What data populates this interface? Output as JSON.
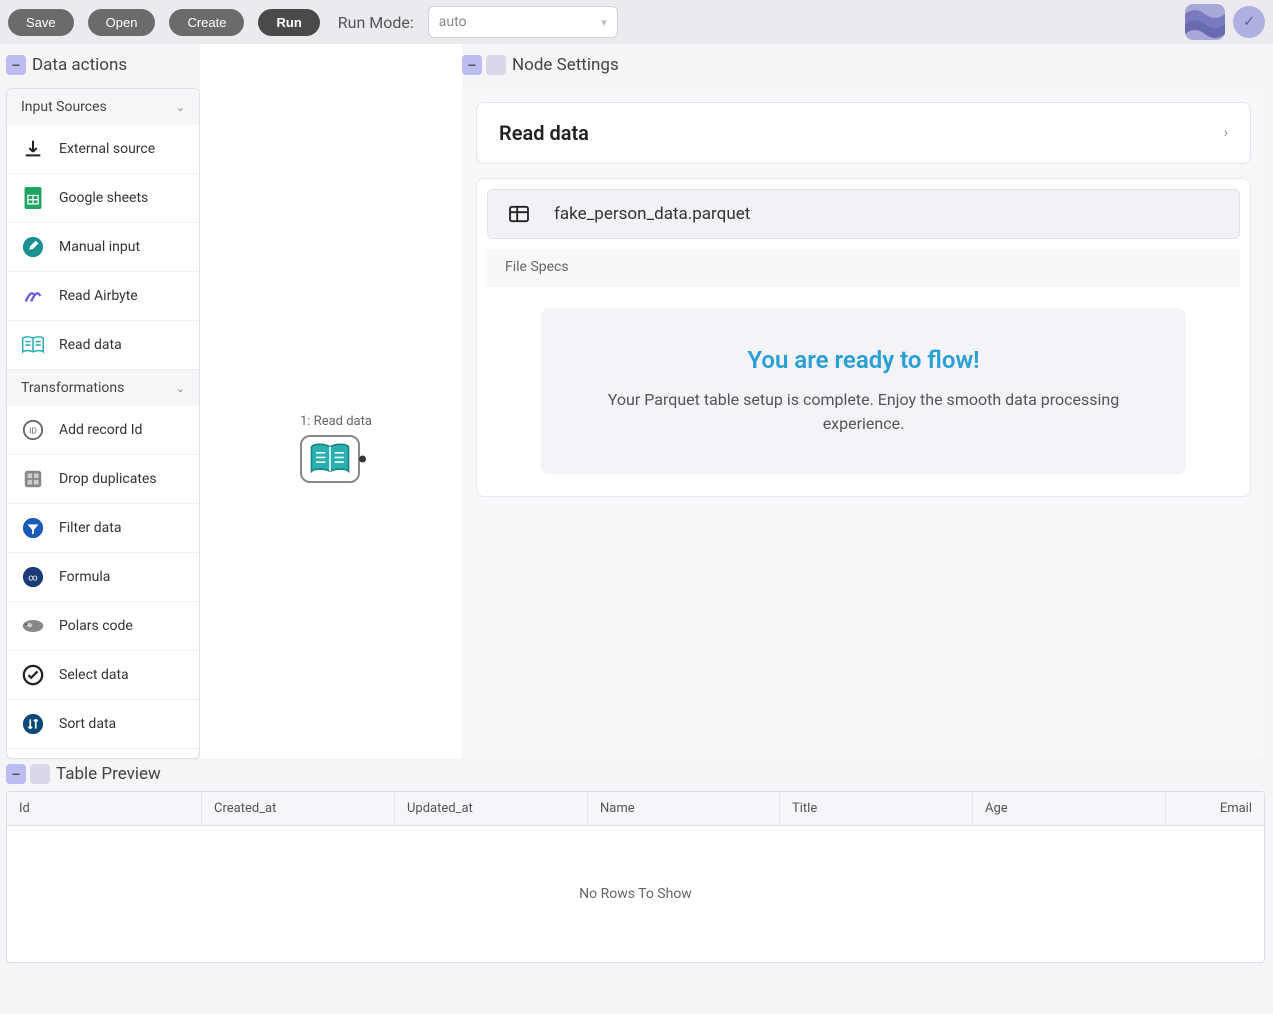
{
  "toolbar": {
    "save": "Save",
    "open": "Open",
    "create": "Create",
    "run": "Run",
    "run_mode_label": "Run Mode:",
    "run_mode_value": "auto"
  },
  "panels": {
    "data_actions": "Data actions",
    "node_settings": "Node Settings",
    "table_preview": "Table Preview"
  },
  "sidebar": {
    "sections": {
      "input_sources": "Input Sources",
      "transformations": "Transformations"
    },
    "input_items": [
      "External source",
      "Google sheets",
      "Manual input",
      "Read Airbyte",
      "Read data"
    ],
    "transform_items": [
      "Add record Id",
      "Drop duplicates",
      "Filter data",
      "Formula",
      "Polars code",
      "Select data",
      "Sort data"
    ]
  },
  "canvas": {
    "node_label": "1: Read data"
  },
  "settings": {
    "node_title": "Read data",
    "file_name": "fake_person_data.parquet",
    "file_specs_label": "File Specs",
    "ready_title": "You are ready to flow!",
    "ready_desc": "Your Parquet table setup is complete. Enjoy the smooth data processing experience."
  },
  "table": {
    "columns": [
      "Id",
      "Created_at",
      "Updated_at",
      "Name",
      "Title",
      "Age",
      "Email"
    ],
    "empty_message": "No Rows To Show"
  }
}
